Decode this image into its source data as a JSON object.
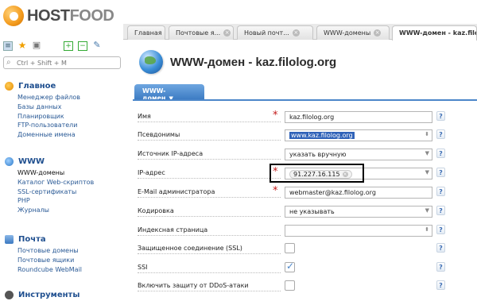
{
  "logo": {
    "part1": "HOST",
    "part2": "FOOD"
  },
  "search": {
    "placeholder": "Ctrl + Shift + M"
  },
  "sidebar": {
    "sections": [
      {
        "title": "Главное",
        "items": [
          "Менеджер файлов",
          "Базы данных",
          "Планировщик",
          "FTP-пользователи",
          "Доменные имена"
        ]
      },
      {
        "title": "WWW",
        "items": [
          "WWW-домены",
          "Каталог Web-скриптов",
          "SSL-сертификаты",
          "PHP",
          "Журналы"
        ],
        "active_item": "WWW-домены"
      },
      {
        "title": "Почта",
        "items": [
          "Почтовые домены",
          "Почтовые ящики",
          "Roundcube WebMail"
        ]
      },
      {
        "title": "Инструменты",
        "items": []
      }
    ]
  },
  "tabs": [
    {
      "label": "Главная",
      "closable": false
    },
    {
      "label": "Почтовые я...",
      "closable": true
    },
    {
      "label": "Новый почт...",
      "closable": true
    },
    {
      "label": "WWW-домены",
      "closable": true
    },
    {
      "label": "WWW-домен - kaz.filo",
      "closable": false,
      "active": true
    }
  ],
  "page": {
    "title": "WWW-домен - kaz.filolog.org",
    "subtab": "WWW-домен",
    "help_icon": "?"
  },
  "form": {
    "name": {
      "label": "Имя",
      "value": "kaz.filolog.org",
      "required": true
    },
    "aliases": {
      "label": "Псевдонимы",
      "value": "www.kaz.filolog.org"
    },
    "ip_source": {
      "label": "Источник IP-адреса",
      "value": "указать вручную"
    },
    "ip": {
      "label": "IP-адрес",
      "value": "91.227.16.115",
      "required": true
    },
    "email": {
      "label": "E-Mail администратора",
      "value": "webmaster@kaz.filolog.org",
      "required": true
    },
    "charset": {
      "label": "Кодировка",
      "value": "не указывать"
    },
    "index": {
      "label": "Индексная страница",
      "value": ""
    },
    "ssl": {
      "label": "Защищенное соединение (SSL)",
      "checked": false
    },
    "ssi": {
      "label": "SSI",
      "checked": true
    },
    "ddos": {
      "label": "Включить защиту от DDoS-атаки",
      "checked": false
    }
  },
  "colors": {
    "accent": "#3d7cc4",
    "required": "#c21818",
    "link": "#2a5a96",
    "highlight_box": "#000000"
  }
}
